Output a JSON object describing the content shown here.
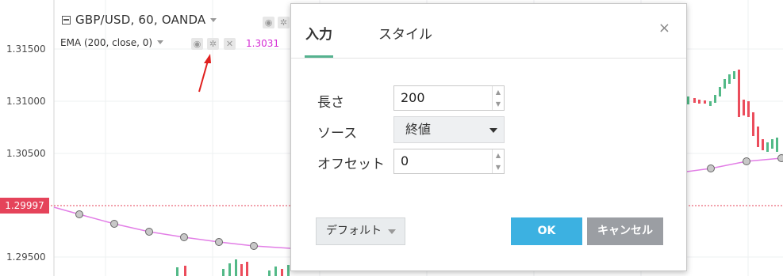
{
  "chart": {
    "symbol_title": "GBP/USD, 60, OANDA",
    "indicator_label": "EMA (200, close, 0)",
    "indicator_value": "1.3031",
    "price_axis": [
      "1.31500",
      "1.31000",
      "1.30500",
      "1.29500"
    ],
    "current_price": "1.29997",
    "colors": {
      "ema": "#e27ee6",
      "current_price": "#e5435a",
      "up_candle": "#53b987",
      "down_candle": "#eb4d5c"
    }
  },
  "dialog": {
    "tabs": [
      "入力",
      "スタイル"
    ],
    "active_tab": "入力",
    "close_label": "×",
    "fields": {
      "length_label": "長さ",
      "length_value": "200",
      "source_label": "ソース",
      "source_value": "終値",
      "offset_label": "オフセット",
      "offset_value": "0"
    },
    "buttons": {
      "default_label": "デフォルト",
      "ok_label": "OK",
      "cancel_label": "キャンセル"
    },
    "colors": {
      "accent": "#55b28f",
      "ok": "#3cb1e1",
      "cancel": "#9b9ea3"
    }
  }
}
